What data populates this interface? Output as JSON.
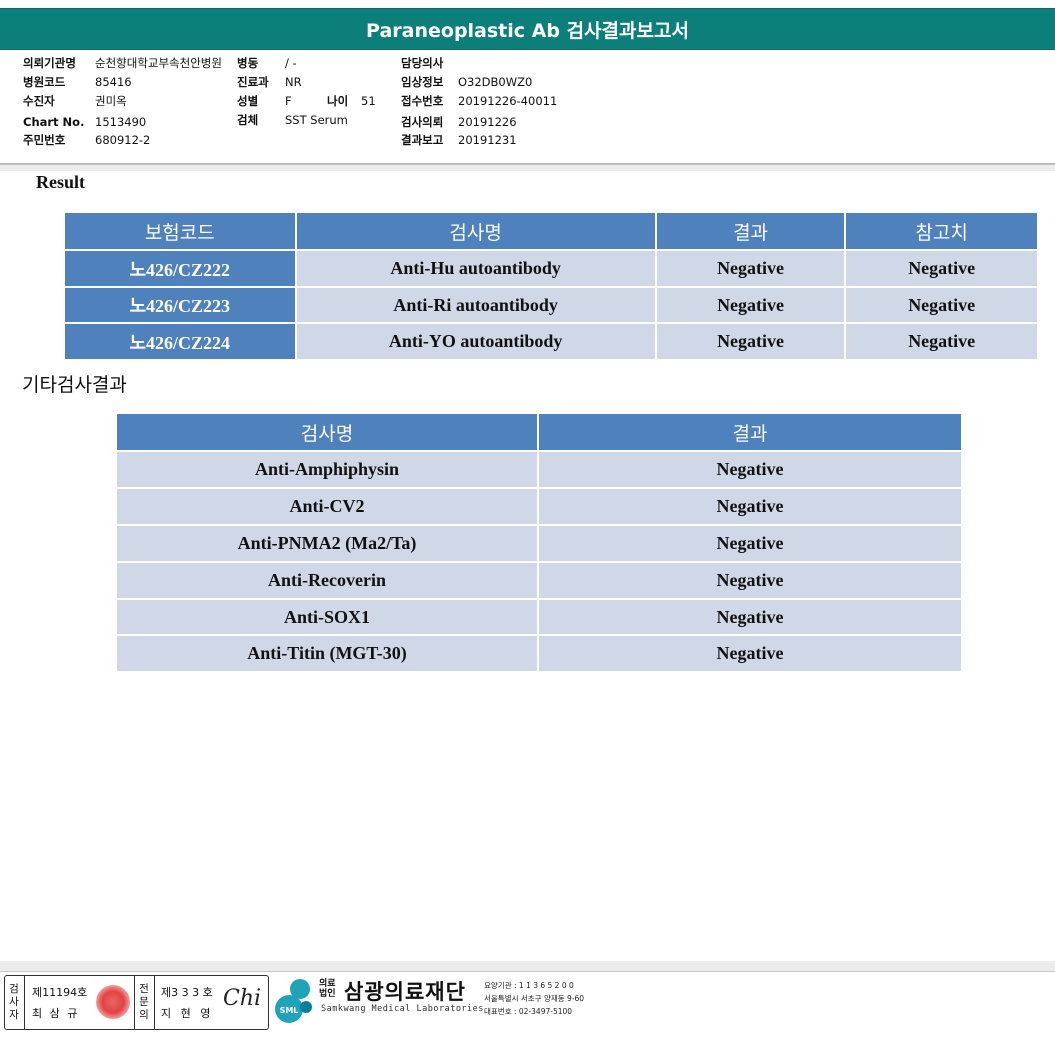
{
  "title": "Paraneoplastic Ab 검사결과보고서",
  "header": {
    "col1": [
      {
        "label": "의뢰기관명",
        "value": "순천향대학교부속천안병원"
      },
      {
        "label": "병원코드",
        "value": "85416"
      },
      {
        "label": "수진자",
        "value": "권미옥"
      },
      {
        "label": "Chart No.",
        "value": "1513490"
      },
      {
        "label": "주민번호",
        "value": "680912-2"
      }
    ],
    "ward": {
      "label": "병동",
      "value": "/ -"
    },
    "dept": {
      "label": "진료과",
      "value": "NR"
    },
    "sex": {
      "label": "성별",
      "value": "F"
    },
    "age": {
      "label": "나이",
      "value": "51"
    },
    "specimen": {
      "label": "검체",
      "value": "SST Serum"
    },
    "col3": [
      {
        "label": "담당의사",
        "value": ""
      },
      {
        "label": "임상정보",
        "value": "O32DB0WZ0"
      },
      {
        "label": "접수번호",
        "value": "20191226-40011"
      },
      {
        "label": "검사의뢰",
        "value": "20191226"
      },
      {
        "label": "결과보고",
        "value": "20191231"
      }
    ]
  },
  "result": {
    "label": "Result",
    "headers": [
      "보험코드",
      "검사명",
      "결과",
      "참고치"
    ],
    "rows": [
      {
        "code": "노426/CZ222",
        "test": "Anti-Hu autoantibody",
        "result": "Negative",
        "reference": "Negative"
      },
      {
        "code": "노426/CZ223",
        "test": "Anti-Ri autoantibody",
        "result": "Negative",
        "reference": "Negative"
      },
      {
        "code": "노426/CZ224",
        "test": "Anti-YO autoantibody",
        "result": "Negative",
        "reference": "Negative"
      }
    ]
  },
  "other": {
    "label": "기타검사결과",
    "headers": [
      "검사명",
      "결과"
    ],
    "rows": [
      {
        "test": "Anti-Amphiphysin",
        "result": "Negative"
      },
      {
        "test": "Anti-CV2",
        "result": "Negative"
      },
      {
        "test": "Anti-PNMA2 (Ma2/Ta)",
        "result": "Negative"
      },
      {
        "test": "Anti-Recoverin",
        "result": "Negative"
      },
      {
        "test": "Anti-SOX1",
        "result": "Negative"
      },
      {
        "test": "Anti-Titin (MGT-30)",
        "result": "Negative"
      }
    ]
  },
  "footer": {
    "inspector_label": "검사자",
    "inspector_no": "제11194호",
    "inspector_name": "최 삼 규",
    "specialist_label": "전문의",
    "specialist_no": "제3 3 3 호",
    "specialist_name": "지 현 영",
    "signature": "Chi",
    "org_prefix_1": "의료",
    "org_prefix_2": "법인",
    "org_name": "삼광의료재단",
    "org_name_en": "Samkwang Medical Laboratories",
    "logo_text": "SML",
    "info_1": "요양기관 : 1 1 3 6 5 2 0 0",
    "info_2": "서울특별시 서초구 양재동 9-60",
    "info_3": "대표번호 : 02-3497-5100"
  },
  "colors": {
    "title_bg": "#0d7f7a",
    "header_blue": "#4f81bd",
    "cell_bg": "#d0d8e8"
  }
}
